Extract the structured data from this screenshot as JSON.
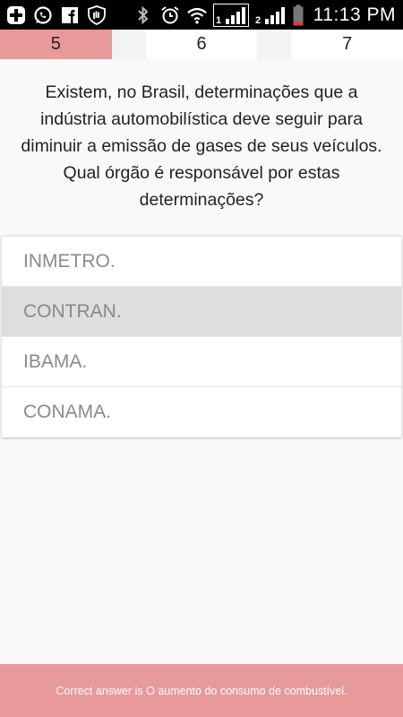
{
  "status_bar": {
    "time": "11:13 PM",
    "icons": [
      "plus-square-icon",
      "whatsapp-icon",
      "facebook-icon",
      "hand-shield-icon",
      "bluetooth-icon",
      "alarm-icon",
      "wifi-icon",
      "signal-sim1-icon",
      "signal-sim2-icon",
      "battery-icon"
    ],
    "sim1_label": "1",
    "sim2_label": "2"
  },
  "question_nav": {
    "items": [
      {
        "label": "5",
        "active": true
      },
      {
        "label": "6",
        "active": false
      },
      {
        "label": "7",
        "active": false
      }
    ]
  },
  "question": {
    "text": "Existem, no Brasil, determinações que a indústria automobilística deve seguir para diminuir a emissão de gases de seus veículos. Qual órgão é responsável por estas determinações?"
  },
  "options": [
    {
      "label": "INMETRO.",
      "selected": false
    },
    {
      "label": "CONTRAN.",
      "selected": true
    },
    {
      "label": "IBAMA.",
      "selected": false
    },
    {
      "label": "CONAMA.",
      "selected": false
    }
  ],
  "footer": {
    "text": "Correct answer is O aumento do consumo de combustível."
  },
  "colors": {
    "accent": "#e8999a",
    "selected_option": "#dedede",
    "option_text": "#8a8a8a"
  }
}
